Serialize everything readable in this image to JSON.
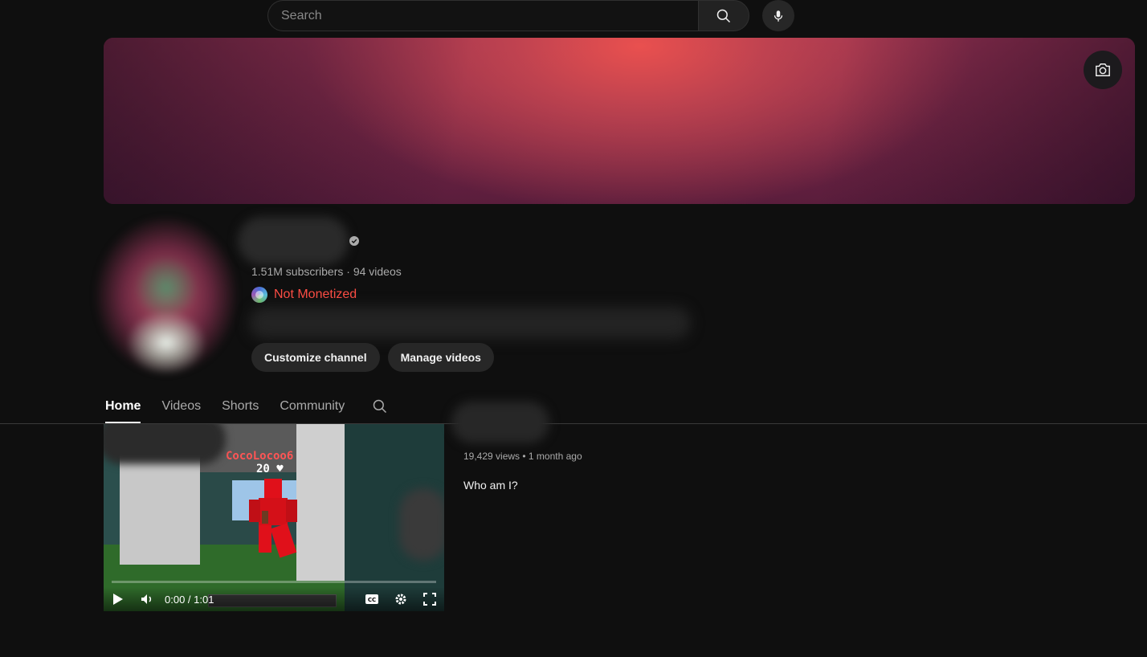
{
  "search": {
    "placeholder": "Search"
  },
  "channel": {
    "stats": "1.51M subscribers · 94 videos",
    "monetization_status": "Not Monetized",
    "customize_label": "Customize channel",
    "manage_label": "Manage videos"
  },
  "tabs": [
    {
      "label": "Home",
      "active": true
    },
    {
      "label": "Videos",
      "active": false
    },
    {
      "label": "Shorts",
      "active": false
    },
    {
      "label": "Community",
      "active": false
    }
  ],
  "featured_video": {
    "player_time": "0:00 / 1:01",
    "overlay_player_name": "CocoLocoo6",
    "overlay_health": "20 ♥",
    "stats": "19,429 views • 1 month ago",
    "description": "Who am I?"
  },
  "colors": {
    "background": "#0f0f0f",
    "accent_red": "#ff4e45",
    "pill": "#272727"
  },
  "icons": [
    "search-icon",
    "mic-icon",
    "camera-icon",
    "verified-icon",
    "play-icon",
    "volume-icon",
    "cc-icon",
    "settings-icon",
    "fullscreen-icon"
  ]
}
